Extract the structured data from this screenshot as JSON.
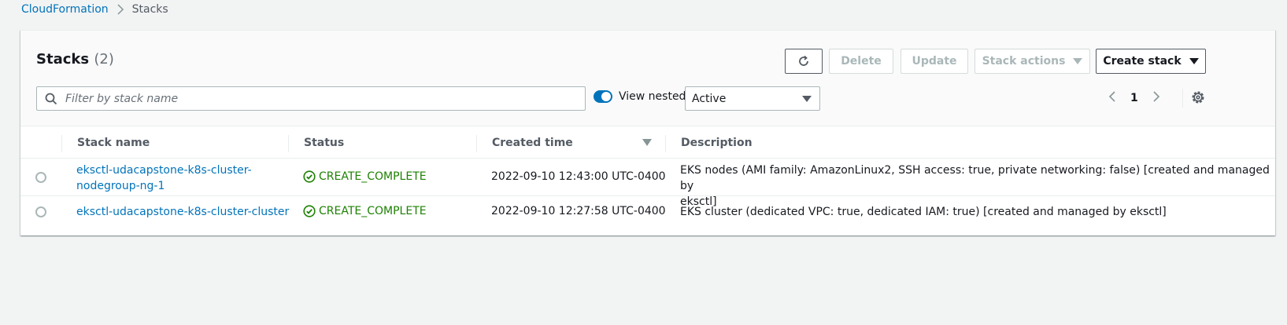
{
  "breadcrumb": {
    "root": "CloudFormation",
    "current": "Stacks"
  },
  "header": {
    "title": "Stacks",
    "count": "(2)"
  },
  "buttons": {
    "delete": "Delete",
    "update": "Update",
    "stack_actions": "Stack actions",
    "create_stack": "Create stack"
  },
  "filter": {
    "placeholder": "Filter by stack name",
    "value": ""
  },
  "view_nested": {
    "label": "View nested",
    "checked": true
  },
  "status_filter": {
    "selected": "Active"
  },
  "pagination": {
    "current_page": "1"
  },
  "table": {
    "columns": {
      "stack_name": "Stack name",
      "status": "Status",
      "created_time": "Created time",
      "description": "Description"
    },
    "rows": [
      {
        "name_line1": "eksctl-udacapstone-k8s-cluster-",
        "name_line2": "nodegroup-ng-1",
        "status": "CREATE_COMPLETE",
        "created": "2022-09-10 12:43:00 UTC-0400",
        "desc_line1": "EKS nodes (AMI family: AmazonLinux2, SSH access: true, private networking: false) [created and managed by",
        "desc_line2": "eksctl]"
      },
      {
        "name_line1": "eksctl-udacapstone-k8s-cluster-cluster",
        "status": "CREATE_COMPLETE",
        "created": "2022-09-10 12:27:58 UTC-0400",
        "desc_line1": "EKS cluster (dedicated VPC: true, dedicated IAM: true) [created and managed by eksctl]"
      }
    ]
  },
  "colors": {
    "link": "#0073bb",
    "success": "#1d8102",
    "toggle": "#0073bb"
  }
}
